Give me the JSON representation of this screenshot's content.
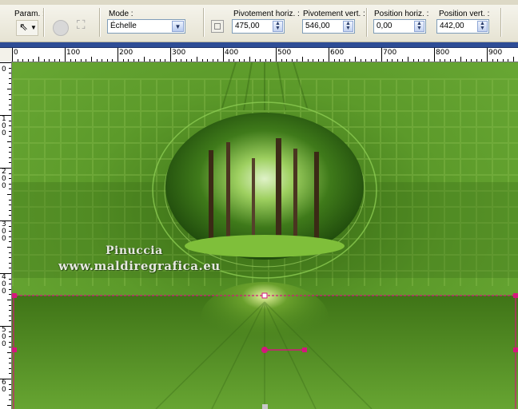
{
  "toolbar": {
    "param_label": "Param. :",
    "mode_label": "Mode :",
    "mode_value": "Échelle",
    "fields": [
      {
        "label": "Pivotement horiz. :",
        "value": "475,00"
      },
      {
        "label": "Pivotement vert. :",
        "value": "546,00"
      },
      {
        "label": "Position horiz. :",
        "value": "0,00"
      },
      {
        "label": "Position vert. :",
        "value": "442,00"
      }
    ]
  },
  "ruler": {
    "h_labels": [
      "0",
      "100",
      "200",
      "300",
      "400",
      "500",
      "600",
      "700",
      "800",
      "900"
    ],
    "v_digits": [
      "0",
      "1",
      "0",
      "0",
      "2",
      "0",
      "0",
      "3",
      "0",
      "0",
      "4",
      "0",
      "0",
      "5",
      "0",
      "0",
      "6",
      "0"
    ]
  },
  "watermark": {
    "name": "Pinuccia",
    "url": "www.maldiregrafica.eu"
  },
  "colors": {
    "canvas_green": "#5a9627",
    "selection_magenta": "#d4177c",
    "accent_blue": "#2e4d96"
  }
}
